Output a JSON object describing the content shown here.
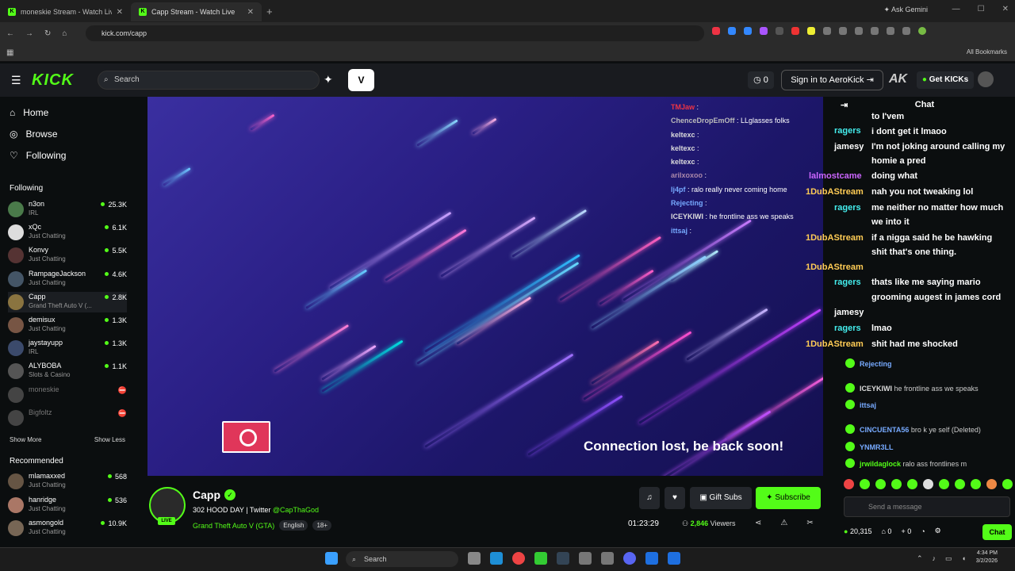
{
  "browser": {
    "tabs": [
      {
        "title": "moneskie Stream - Watch Live"
      },
      {
        "title": "Capp Stream - Watch Live"
      }
    ],
    "new_tab": "+",
    "gemini": "Ask Gemini",
    "url": "kick.com/capp",
    "all_bookmarks": "All Bookmarks",
    "window_controls": [
      "—",
      "☐",
      "✕"
    ]
  },
  "header": {
    "logo": "KICK",
    "search_placeholder": "Search",
    "notif_count": "0",
    "sign_in": "Sign in to AeroKick",
    "ak": "AK",
    "get_kicks": "Get KICKs"
  },
  "sidebar": {
    "nav": [
      {
        "label": "Home",
        "icon": "home-icon"
      },
      {
        "label": "Browse",
        "icon": "compass-icon"
      },
      {
        "label": "Following",
        "icon": "heart-icon"
      }
    ],
    "following_title": "Following",
    "following": [
      {
        "name": "n3on",
        "category": "IRL",
        "viewers": "25.3K",
        "color": "#4a7a4a"
      },
      {
        "name": "xQc",
        "category": "Just Chatting",
        "viewers": "6.1K",
        "color": "#ddd"
      },
      {
        "name": "Konvy",
        "category": "Just Chatting",
        "viewers": "5.5K",
        "color": "#553333"
      },
      {
        "name": "RampageJackson",
        "category": "Just Chatting",
        "viewers": "4.6K",
        "color": "#445566"
      },
      {
        "name": "Capp",
        "category": "Grand Theft Auto V (...",
        "viewers": "2.8K",
        "color": "#8a7440"
      },
      {
        "name": "demisux",
        "category": "Just Chatting",
        "viewers": "1.3K",
        "color": "#775544"
      },
      {
        "name": "jaystayupp",
        "category": "IRL",
        "viewers": "1.3K",
        "color": "#3b4a6b"
      },
      {
        "name": "ALYBOBA",
        "category": "Slots & Casino",
        "viewers": "1.1K",
        "color": "#555"
      },
      {
        "name": "moneskie",
        "category": "",
        "viewers": "",
        "color": "#444"
      },
      {
        "name": "Bigfoltz",
        "category": "",
        "viewers": "",
        "color": "#444"
      }
    ],
    "show_more": "Show More",
    "show_less": "Show Less",
    "recommended_title": "Recommended",
    "recommended": [
      {
        "name": "mlamaxxed",
        "category": "Just Chatting",
        "viewers": "568",
        "color": "#665544"
      },
      {
        "name": "hanridge",
        "category": "Just Chatting",
        "viewers": "536",
        "color": "#aa7766"
      },
      {
        "name": "asmongold",
        "category": "Just Chatting",
        "viewers": "10.9K",
        "color": "#776655"
      }
    ]
  },
  "player": {
    "overlay_chat": [
      {
        "user": "TMJaw",
        "text": ":",
        "color": "#e34"
      },
      {
        "user": "ChenceDropEmOff",
        "text": ": LLglasses folks",
        "color": "#bbb"
      },
      {
        "user": "keltexc",
        "text": ":",
        "color": "#ddd"
      },
      {
        "user": "keltexc",
        "text": ":",
        "color": "#ddd"
      },
      {
        "user": "keltexc",
        "text": ":",
        "color": "#ddd"
      },
      {
        "user": "arilxoxoo",
        "text": ":",
        "color": "#a8a"
      },
      {
        "user": "lj4pf",
        "text": ": ralo really never coming home",
        "color": "#7af"
      },
      {
        "user": "Rejecting",
        "text": ":",
        "color": "#7af"
      },
      {
        "user": "ICEYKIWI",
        "text": ": he frontline ass we speaks",
        "color": "#ddd"
      },
      {
        "user": "ittsaj",
        "text": ":",
        "color": "#7af"
      }
    ],
    "connection_msg": "Connection lost, be back soon!"
  },
  "stream": {
    "name": "Capp",
    "title_prefix": "302 HOOD DAY | Twitter",
    "twitter": "@CapThaGod",
    "category": "Grand Theft Auto V (GTA)",
    "tags": [
      "English",
      "18+"
    ],
    "live": "LIVE",
    "gift_subs": "Gift Subs",
    "subscribe": "Subscribe",
    "uptime": "01:23:29",
    "viewers": "2,846",
    "viewers_label": "Viewers"
  },
  "chat": {
    "title": "Chat",
    "overlay_users": [
      {
        "name": "ragers",
        "color": "#4ee"
      },
      {
        "name": "jamesy",
        "color": "#fff"
      },
      {
        "name": "lalmostcame",
        "color": "#c6f"
      },
      {
        "name": "1DubAStream",
        "color": "#fc5"
      },
      {
        "name": "ragers",
        "color": "#4ee"
      },
      {
        "name": "1DubAStream",
        "color": "#fc5"
      },
      {
        "name": "1DubAStream",
        "color": "#fc5"
      },
      {
        "name": "ragers",
        "color": "#4ee"
      },
      {
        "name": "jamesy",
        "color": "#fff"
      },
      {
        "name": "ragers",
        "color": "#4ee"
      },
      {
        "name": "1DubAStream",
        "color": "#fc5"
      }
    ],
    "overlay_lines": [
      "to I'vem",
      "i dont get it lmaoo",
      "I'm not joking around calling my",
      "homie a pred",
      "doing what",
      "nah you not tweaking lol",
      "me neither no matter how much",
      "we into it",
      "if a nigga said he be hawking",
      "shit that's one thing.",
      "thats like me saying mario",
      "grooming augest in james cord",
      "lmao",
      "shit had me shocked"
    ],
    "messages": [
      {
        "user": "Rejecting",
        "text": "",
        "color": "#7af"
      },
      {
        "user": "ICEYKIWI",
        "text": "he frontline ass we speaks",
        "color": "#ddd"
      },
      {
        "user": "ittsaj",
        "text": "",
        "color": "#7af"
      },
      {
        "user": "CINCUENTA56",
        "text": "bro k ye self (Deleted)",
        "color": "#7af"
      },
      {
        "user": "YNMR3LL",
        "text": "",
        "color": "#7af"
      },
      {
        "user": "jrwildaglock",
        "text": "ralo ass frontlines m",
        "color": "#53fc18"
      }
    ],
    "placeholder": "Send a message",
    "kicks": "20,315",
    "count_a": "0",
    "count_b": "0",
    "chat_button": "Chat"
  },
  "taskbar": {
    "search": "Search",
    "time": "4:34 PM",
    "date": "3/2/2026"
  }
}
